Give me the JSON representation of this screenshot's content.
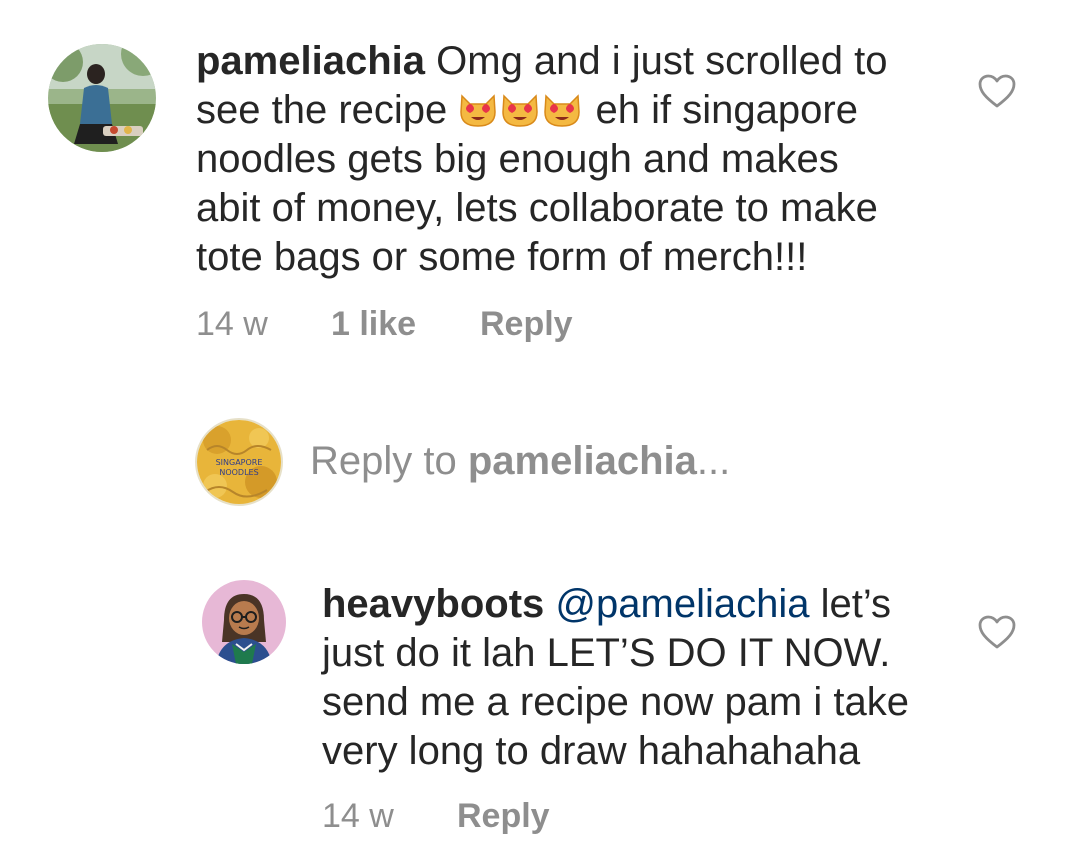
{
  "comment": {
    "username": "pameliachia",
    "lines": [
      "Omg and i just scrolled to",
      "see the recipe",
      "eh if singapore",
      "noodles gets big enough and makes",
      "abit of money, lets collaborate to make",
      "tote bags or some form of merch!!!"
    ],
    "emoji": [
      "heart-eyes-cat-emoji",
      "heart-eyes-cat-emoji",
      "heart-eyes-cat-emoji"
    ],
    "time": "14 w",
    "likes": "1 like",
    "reply_label": "Reply"
  },
  "compose": {
    "prefix": "Reply to ",
    "target": "pameliachia",
    "suffix": "...",
    "avatar_text": [
      "SINGAPORE",
      "NOODLES"
    ]
  },
  "reply": {
    "username": "heavyboots",
    "mention": "@pameliachia",
    "lines": [
      "let’s",
      "just do it lah LET’S DO IT NOW.",
      "send me a recipe now pam i take",
      "very long to draw hahahahaha"
    ],
    "time": "14 w",
    "reply_label": "Reply"
  },
  "colors": {
    "text": "#262626",
    "meta": "#8e8e8e",
    "mention": "#003569",
    "icon_stroke": "#8e8e8e"
  }
}
